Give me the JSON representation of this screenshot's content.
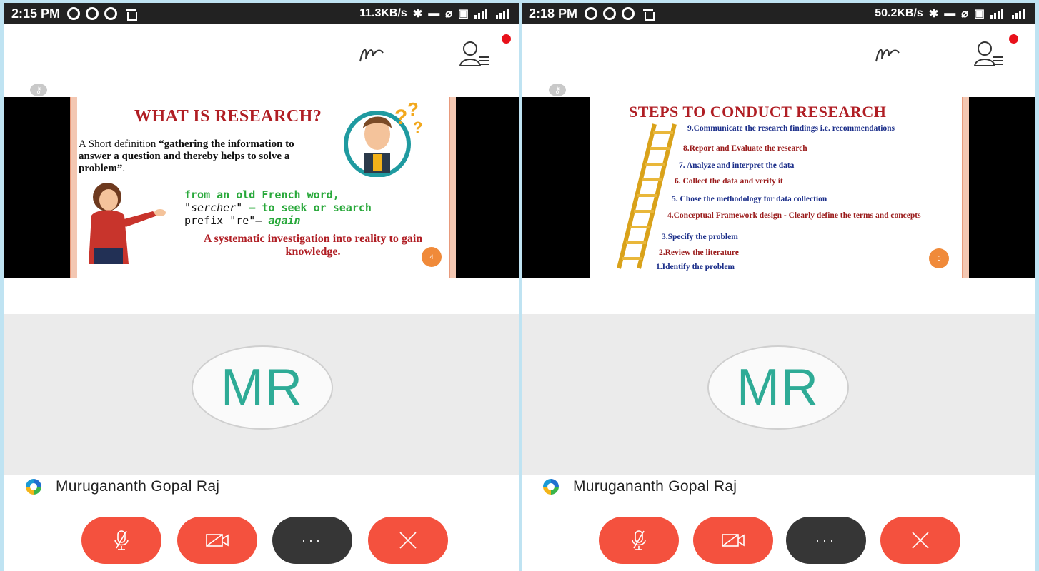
{
  "colors": {
    "accent_red": "#f4513e",
    "dark_button": "#363636",
    "avatar_text": "#2eab96",
    "notification_dot": "#e8101a"
  },
  "panels": [
    {
      "status": {
        "time": "2:15 PM",
        "speed": "11.3KB/s"
      },
      "slide": {
        "title": "WHAT IS RESEARCH?",
        "definition_prefix": "A Short definition ",
        "definition_quote": "“gathering the information to answer a question and thereby helps to solve a problem”",
        "definition_suffix": ".",
        "etym_line1": "from an old French word,",
        "etym_line2_word": "\"sercher\"",
        "etym_line2_rest": " – to seek or search",
        "etym_line3_prefix": "prefix \"re\"– ",
        "etym_line3_word": "again",
        "systematic": "A systematic investigation into reality to gain knowledge.",
        "page": "4"
      },
      "avatar_initials": "MR",
      "participant_name": "Murugananth Gopal Raj"
    },
    {
      "status": {
        "time": "2:18 PM",
        "speed": "50.2KB/s"
      },
      "slide": {
        "title": "STEPS TO CONDUCT RESEARCH",
        "steps": [
          "9.Communicate the research findings i.e. recommendations",
          "8.Report and Evaluate the research",
          "7. Analyze and interpret the data",
          "6. Collect the data and verify it",
          "5. Chose the methodology for data collection",
          "4.Conceptual Framework design - Clearly define the terms and concepts",
          "3.Specify the problem",
          "2.Review the literature",
          "1.Identify the problem"
        ],
        "page": "6"
      },
      "avatar_initials": "MR",
      "participant_name": "Murugananth Gopal Raj"
    }
  ],
  "controls": {
    "mute_icon": "mic-muted-icon",
    "video_icon": "video-off-icon",
    "more_label": "···",
    "end_icon": "close-icon"
  }
}
